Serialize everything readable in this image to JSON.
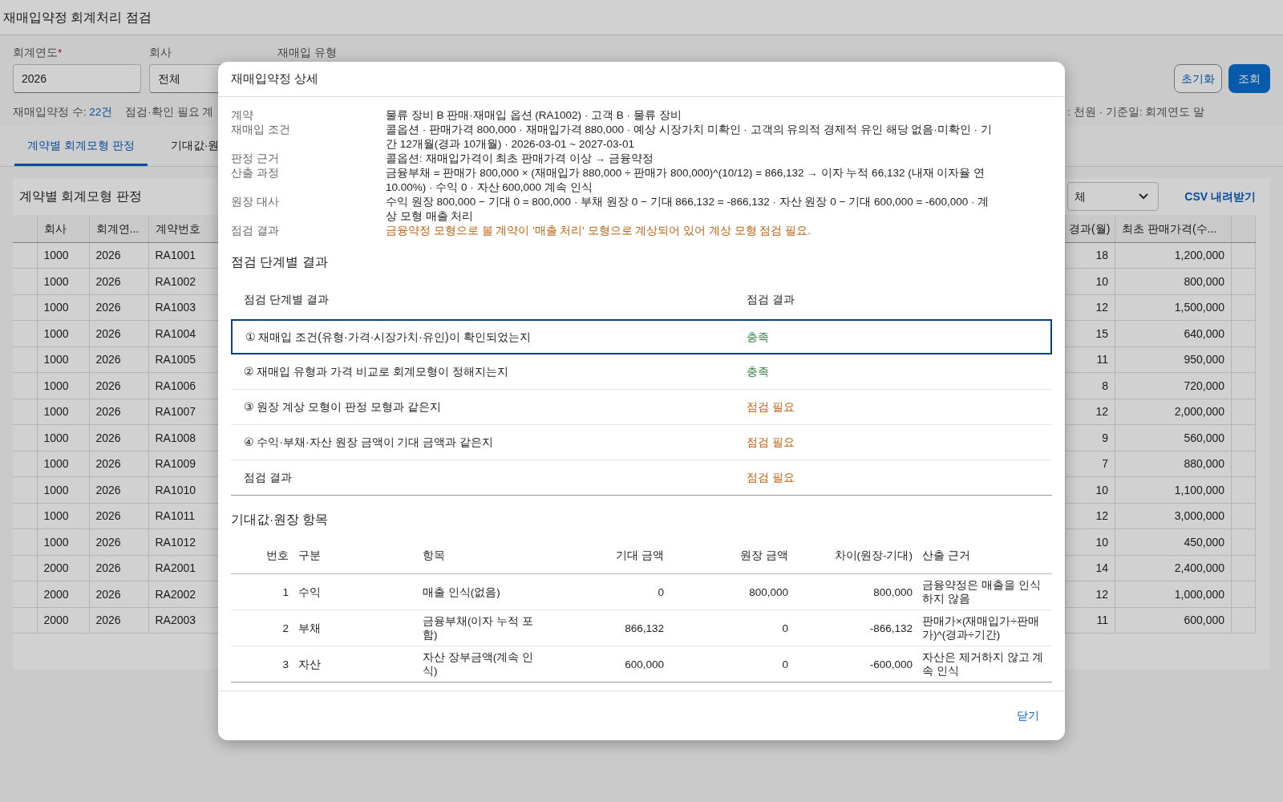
{
  "page": {
    "title": "재매입약정 회계처리 점검"
  },
  "filters": [
    {
      "label": "회계연도",
      "required_mark": "*",
      "value": "2026"
    },
    {
      "label": "회사",
      "value": "전체"
    },
    {
      "label": "재매입 유형"
    }
  ],
  "buttons": [
    {
      "label": "초기화",
      "kind": "secondary"
    },
    {
      "label": "조회",
      "kind": "primary"
    }
  ],
  "summary": {
    "count_label": "재매입약정 수:",
    "count_value": "22건",
    "needs_check": "점검·확인 필요 계",
    "unit_note": ": 천원 · 기준일: 회계연도 말"
  },
  "tabs": [
    {
      "label": "계약별 회계모형 판정",
      "selected": true
    },
    {
      "label": "기대값·원",
      "selected": false
    }
  ],
  "card": {
    "title": "계약별 회계모형 판정",
    "filter_value": "체",
    "download_link": "CSV 내려받기"
  },
  "table": {
    "columns": [
      "회사",
      "회계연...",
      "계약번호",
      "경과(월)",
      "최초 판매가격(수..."
    ],
    "rows": [
      {
        "company": "1000",
        "year": "2026",
        "contract": "RA1001",
        "elapsed": "18",
        "price": "1,200,000"
      },
      {
        "company": "1000",
        "year": "2026",
        "contract": "RA1002",
        "elapsed": "10",
        "price": "800,000"
      },
      {
        "company": "1000",
        "year": "2026",
        "contract": "RA1003",
        "elapsed": "12",
        "price": "1,500,000"
      },
      {
        "company": "1000",
        "year": "2026",
        "contract": "RA1004",
        "elapsed": "15",
        "price": "640,000"
      },
      {
        "company": "1000",
        "year": "2026",
        "contract": "RA1005",
        "elapsed": "11",
        "price": "950,000"
      },
      {
        "company": "1000",
        "year": "2026",
        "contract": "RA1006",
        "elapsed": "8",
        "price": "720,000"
      },
      {
        "company": "1000",
        "year": "2026",
        "contract": "RA1007",
        "elapsed": "12",
        "price": "2,000,000"
      },
      {
        "company": "1000",
        "year": "2026",
        "contract": "RA1008",
        "elapsed": "9",
        "price": "560,000"
      },
      {
        "company": "1000",
        "year": "2026",
        "contract": "RA1009",
        "elapsed": "7",
        "price": "880,000"
      },
      {
        "company": "1000",
        "year": "2026",
        "contract": "RA1010",
        "elapsed": "10",
        "price": "1,100,000"
      },
      {
        "company": "1000",
        "year": "2026",
        "contract": "RA1011",
        "elapsed": "12",
        "price": "3,000,000"
      },
      {
        "company": "1000",
        "year": "2026",
        "contract": "RA1012",
        "elapsed": "10",
        "price": "450,000"
      },
      {
        "company": "2000",
        "year": "2026",
        "contract": "RA2001",
        "elapsed": "14",
        "price": "2,400,000"
      },
      {
        "company": "2000",
        "year": "2026",
        "contract": "RA2002",
        "elapsed": "12",
        "price": "1,000,000"
      },
      {
        "company": "2000",
        "year": "2026",
        "contract": "RA2003",
        "elapsed": "11",
        "price": "600,000"
      }
    ]
  },
  "modal": {
    "title": "재매입약정 상세",
    "details": [
      {
        "label": "계약",
        "value": "물류 장비 B 판매·재매입 옵션 (RA1002) · 고객 B · 물류 장비",
        "kind": "normal"
      },
      {
        "label": "재매입 조건",
        "value": "콜옵션 · 판매가격 800,000 · 재매입가격 880,000 · 예상 시장가치 미확인 · 고객의 유의적 경제적 유인 해당 없음·미확인 · 기간 12개월(경과 10개월) · 2026-03-01 ~ 2027-03-01",
        "kind": "normal"
      },
      {
        "label": "판정 근거",
        "value": "콜옵션: 재매입가격이 최초 판매가격 이상 → 금융약정",
        "kind": "normal"
      },
      {
        "label": "산출 과정",
        "value": "금융부채 = 판매가 800,000 × (재매입가 880,000 ÷ 판매가 800,000)^(10/12) = 866,132 → 이자 누적 66,132 (내재 이자율 연 10.00%) · 수익 0 · 자산 600,000 계속 인식",
        "kind": "normal"
      },
      {
        "label": "원장 대사",
        "value": "수익 원장 800,000 − 기대 0 = 800,000 · 부채 원장 0 − 기대 866,132 = -866,132 · 자산 원장 0 − 기대 600,000 = -600,000 · 계상 모형 매출 처리",
        "kind": "normal"
      },
      {
        "label": "점검 결과",
        "value": "금융약정 모형으로 볼 계약이 '매출 처리' 모형으로 계상되어 있어 계상 모형 점검 필요.",
        "kind": "warning"
      }
    ],
    "steps_title": "점검 단계별 결과",
    "steps": {
      "columns": [
        "점검 단계별 결과",
        "점검 결과"
      ],
      "rows": [
        {
          "label": "① 재매입 조건(유형·가격·시장가치·유인)이 확인되었는지",
          "result": "충족",
          "color": "#2b7a3b",
          "selected": true
        },
        {
          "label": "② 재매입 유형과 가격 비교로 회계모형이 정해지는지",
          "result": "충족",
          "color": "#2b7a3b",
          "selected": false
        },
        {
          "label": "③ 원장 계상 모형이 판정 모형과 같은지",
          "result": "점검 필요",
          "color": "#c0600f",
          "selected": false
        },
        {
          "label": "④ 수익·부채·자산 원장 금액이 기대 금액과 같은지",
          "result": "점검 필요",
          "color": "#c0600f",
          "selected": false
        },
        {
          "label": "점검 결과",
          "result": "점검 필요",
          "color": "#c0600f",
          "selected": false
        }
      ]
    },
    "ledger_title": "기대값·원장 항목",
    "ledger": {
      "columns": [
        "번호",
        "구분",
        "항목",
        "기대 금액",
        "원장 금액",
        "차이(원장-기대)",
        "산출 근거"
      ],
      "rows": [
        {
          "no": "1",
          "category": "수익",
          "item": "매출 인식(없음)",
          "expected": "0",
          "ledger": "800,000",
          "diff": "800,000",
          "basis": "금융약정은 매출을 인식하지 않음"
        },
        {
          "no": "2",
          "category": "부채",
          "item": "금융부채(이자 누적 포함)",
          "expected": "866,132",
          "ledger": "0",
          "diff": "-866,132",
          "basis": "판매가×(재매입가÷판매가)^(경과÷기간)"
        },
        {
          "no": "3",
          "category": "자산",
          "item": "자산 장부금액(계속 인식)",
          "expected": "600,000",
          "ledger": "0",
          "diff": "-600,000",
          "basis": "자산은 제거하지 않고 계속 인식"
        }
      ]
    },
    "close": "닫기"
  }
}
